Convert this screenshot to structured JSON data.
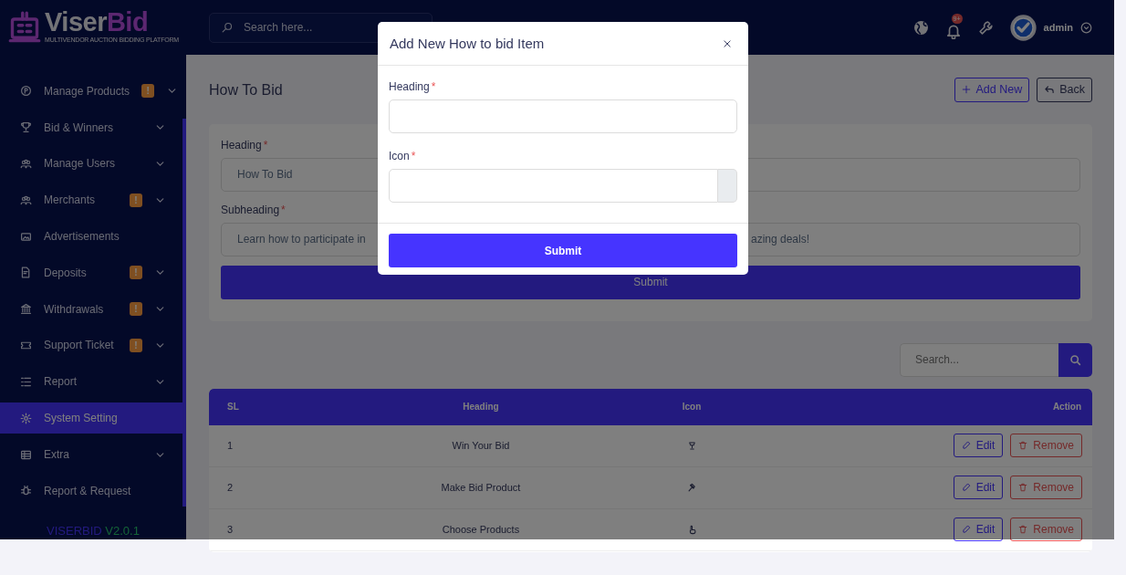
{
  "sidebar": {
    "logo": {
      "name_start": "Viser",
      "name_end": "Bid",
      "tagline": "MULTIVENDOR AUCTION BIDDING PLATFORM"
    },
    "items": [
      {
        "label": "Manage Products",
        "badge": "!",
        "expandable": true,
        "selected": false
      },
      {
        "label": "Bid & Winners",
        "expandable": true,
        "selected": false
      },
      {
        "label": "Manage Users",
        "expandable": true,
        "selected": false
      },
      {
        "label": "Merchants",
        "badge": "!",
        "expandable": true,
        "selected": false
      },
      {
        "label": "Advertisements",
        "expandable": false,
        "selected": false
      },
      {
        "label": "Deposits",
        "badge": "!",
        "expandable": true,
        "selected": false
      },
      {
        "label": "Withdrawals",
        "badge": "!",
        "expandable": true,
        "selected": false
      },
      {
        "label": "Support Ticket",
        "badge": "!",
        "expandable": true,
        "selected": false
      },
      {
        "label": "Report",
        "expandable": true,
        "selected": false
      },
      {
        "label": "System Setting",
        "expandable": false,
        "selected": true
      },
      {
        "label": "Extra",
        "expandable": true,
        "selected": false
      },
      {
        "label": "Report & Request",
        "expandable": false,
        "selected": false
      }
    ],
    "version": {
      "brand": "VISERBID",
      "number": "V2.0.1"
    }
  },
  "topbar": {
    "search": {
      "placeholder": "Search here..."
    },
    "notification_count": "9+",
    "user": "admin"
  },
  "page": {
    "title": "How To Bid",
    "add_button": "Add New",
    "back_button": "Back"
  },
  "form": {
    "fields": [
      {
        "label": "Heading",
        "required_mark": "*",
        "value_parts": [
          "How To Bid"
        ]
      },
      {
        "label": "Subheading",
        "required_mark": "*",
        "value_parts": [
          "Learn how to participate in",
          "azing deals!"
        ]
      }
    ],
    "submit": "Submit"
  },
  "table": {
    "search": {
      "placeholder": "Search..."
    },
    "columns": [
      "SL",
      "Heading",
      "Icon",
      "Action"
    ],
    "rows": [
      {
        "sl": "1",
        "heading": "Win Your Bid",
        "edit": "Edit",
        "remove": "Remove"
      },
      {
        "sl": "2",
        "heading": "Make Bid Product",
        "edit": "Edit",
        "remove": "Remove"
      },
      {
        "sl": "3",
        "heading": "Choose Products",
        "edit": "Edit",
        "remove": "Remove"
      }
    ]
  },
  "modal": {
    "title": "Add New How to bid Item",
    "fields": [
      {
        "label": "Heading",
        "required_mark": "*",
        "kind": "text"
      },
      {
        "label": "Icon",
        "required_mark": "*",
        "kind": "icon-picker"
      }
    ],
    "submit": "Submit"
  }
}
